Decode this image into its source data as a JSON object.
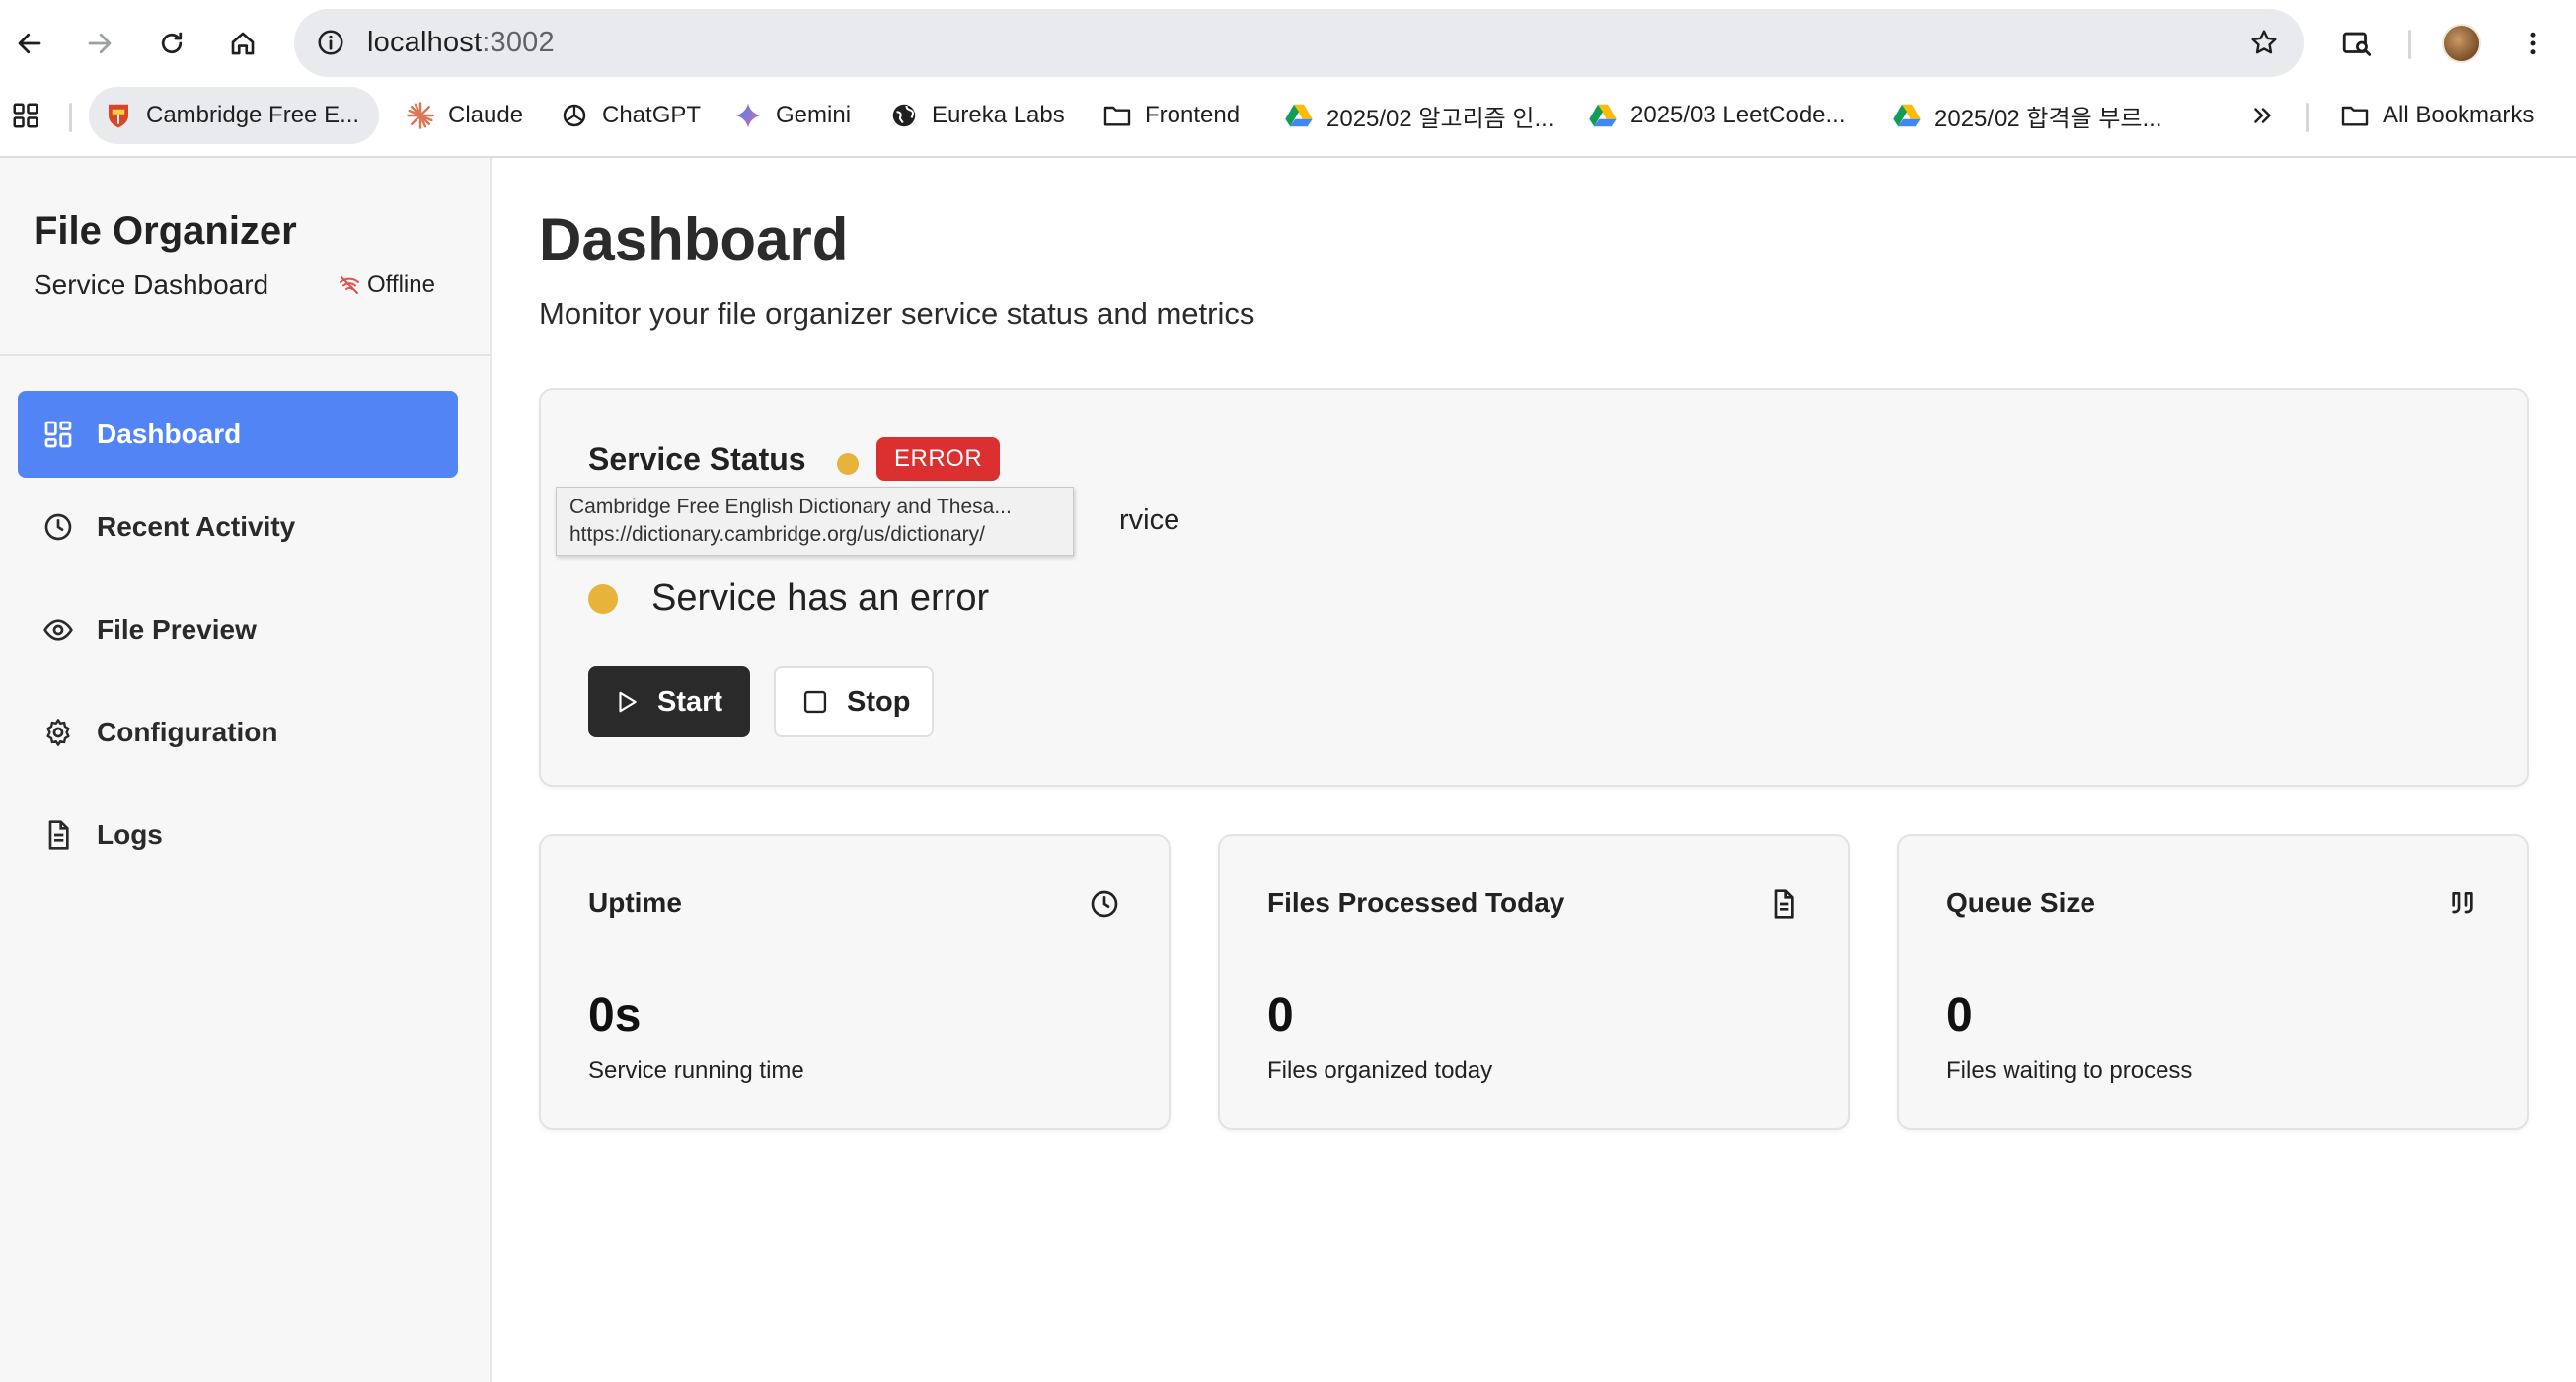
{
  "browser": {
    "url_host": "localhost",
    "url_port": ":3002",
    "bookmarks": [
      {
        "label": "Cambridge Free E...",
        "icon": "cambridge-shield-icon"
      },
      {
        "label": "Claude",
        "icon": "claude-icon"
      },
      {
        "label": "ChatGPT",
        "icon": "chatgpt-icon"
      },
      {
        "label": "Gemini",
        "icon": "gemini-icon"
      },
      {
        "label": "Eureka Labs",
        "icon": "globe-icon"
      },
      {
        "label": "Frontend",
        "icon": "folder-icon"
      },
      {
        "label": "2025/02 알고리즘 인...",
        "icon": "google-drive-icon"
      },
      {
        "label": "2025/03 LeetCode...",
        "icon": "google-drive-icon"
      },
      {
        "label": "2025/02 합격을 부르...",
        "icon": "google-drive-icon"
      }
    ],
    "all_bookmarks": "All Bookmarks",
    "tooltip": {
      "title": "Cambridge Free English Dictionary and Thesa...",
      "url": "https://dictionary.cambridge.org/us/dictionary/"
    }
  },
  "sidebar": {
    "title": "File Organizer",
    "subtitle": "Service Dashboard",
    "connection": "Offline",
    "items": [
      {
        "label": "Dashboard",
        "icon": "grid-icon",
        "active": true
      },
      {
        "label": "Recent Activity",
        "icon": "clock-icon"
      },
      {
        "label": "File Preview",
        "icon": "eye-icon"
      },
      {
        "label": "Configuration",
        "icon": "gear-icon"
      },
      {
        "label": "Logs",
        "icon": "document-icon"
      }
    ]
  },
  "main": {
    "title": "Dashboard",
    "subtitle": "Monitor your file organizer service status and metrics",
    "status": {
      "title": "Service Status",
      "badge": "ERROR",
      "description_visible": "rvice",
      "message": "Service has an error",
      "start_label": "Start",
      "stop_label": "Stop"
    },
    "metrics": [
      {
        "title": "Uptime",
        "value": "0s",
        "desc": "Service running time",
        "icon": "clock-icon"
      },
      {
        "title": "Files Processed Today",
        "value": "0",
        "desc": "Files organized today",
        "icon": "document-icon"
      },
      {
        "title": "Queue Size",
        "value": "0",
        "desc": "Files waiting to process",
        "icon": "queue-icon"
      }
    ]
  },
  "colors": {
    "accent": "#5384f6",
    "error": "#dc2f2f",
    "status_dot": "#e8b33a",
    "dark_button": "#2a2a2a"
  }
}
